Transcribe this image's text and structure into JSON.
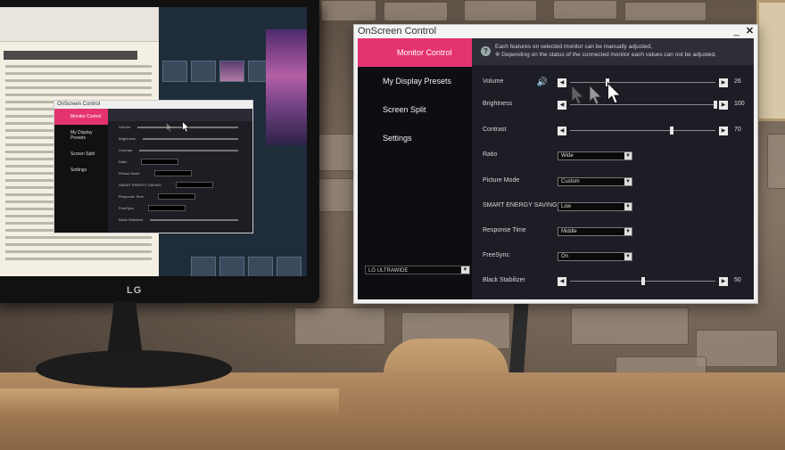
{
  "window": {
    "title": "OnScreen Control",
    "minimize_label": "_",
    "close_label": "✕"
  },
  "sidebar": {
    "items": [
      {
        "label": "Monitor Control",
        "active": true
      },
      {
        "label": "My Display Presets",
        "active": false
      },
      {
        "label": "Screen Split",
        "active": false
      },
      {
        "label": "Settings",
        "active": false
      }
    ],
    "monitor_select": "LG ULTRAWIDE"
  },
  "info": {
    "icon": "question-icon",
    "line1": "Each features on selected monitor can be manually adjusted,",
    "line2": "※ Depending on the status of the connected monitor each values can not be adjusted,"
  },
  "controls": {
    "volume": {
      "label": "Volume",
      "value": "26",
      "level": 0.26
    },
    "brightness": {
      "label": "Brightness",
      "value": "100",
      "level": 1.0
    },
    "contrast": {
      "label": "Contrast",
      "value": "70",
      "level": 0.7
    },
    "ratio": {
      "label": "Ratio",
      "selected": "Wide"
    },
    "picture_mode": {
      "label": "Picture Mode",
      "selected": "Custom"
    },
    "smart_energy": {
      "label": "SMART ENERGY SAVING",
      "selected": "Low"
    },
    "response_time": {
      "label": "Response Time",
      "selected": "Middle"
    },
    "freesync": {
      "label": "FreeSync",
      "selected": "On"
    },
    "black_stabilizer": {
      "label": "Black Stabilizer",
      "value": "50",
      "level": 0.5
    }
  },
  "icons": {
    "slider_left": "◀",
    "slider_right": "▶",
    "dropdown_arrow": "▼",
    "speaker": "🔊"
  },
  "monitor": {
    "brand": "LG"
  },
  "colors": {
    "accent": "#e5336f",
    "panel_bg": "#1d1d25",
    "sidebar_bg": "#0e0e12"
  }
}
